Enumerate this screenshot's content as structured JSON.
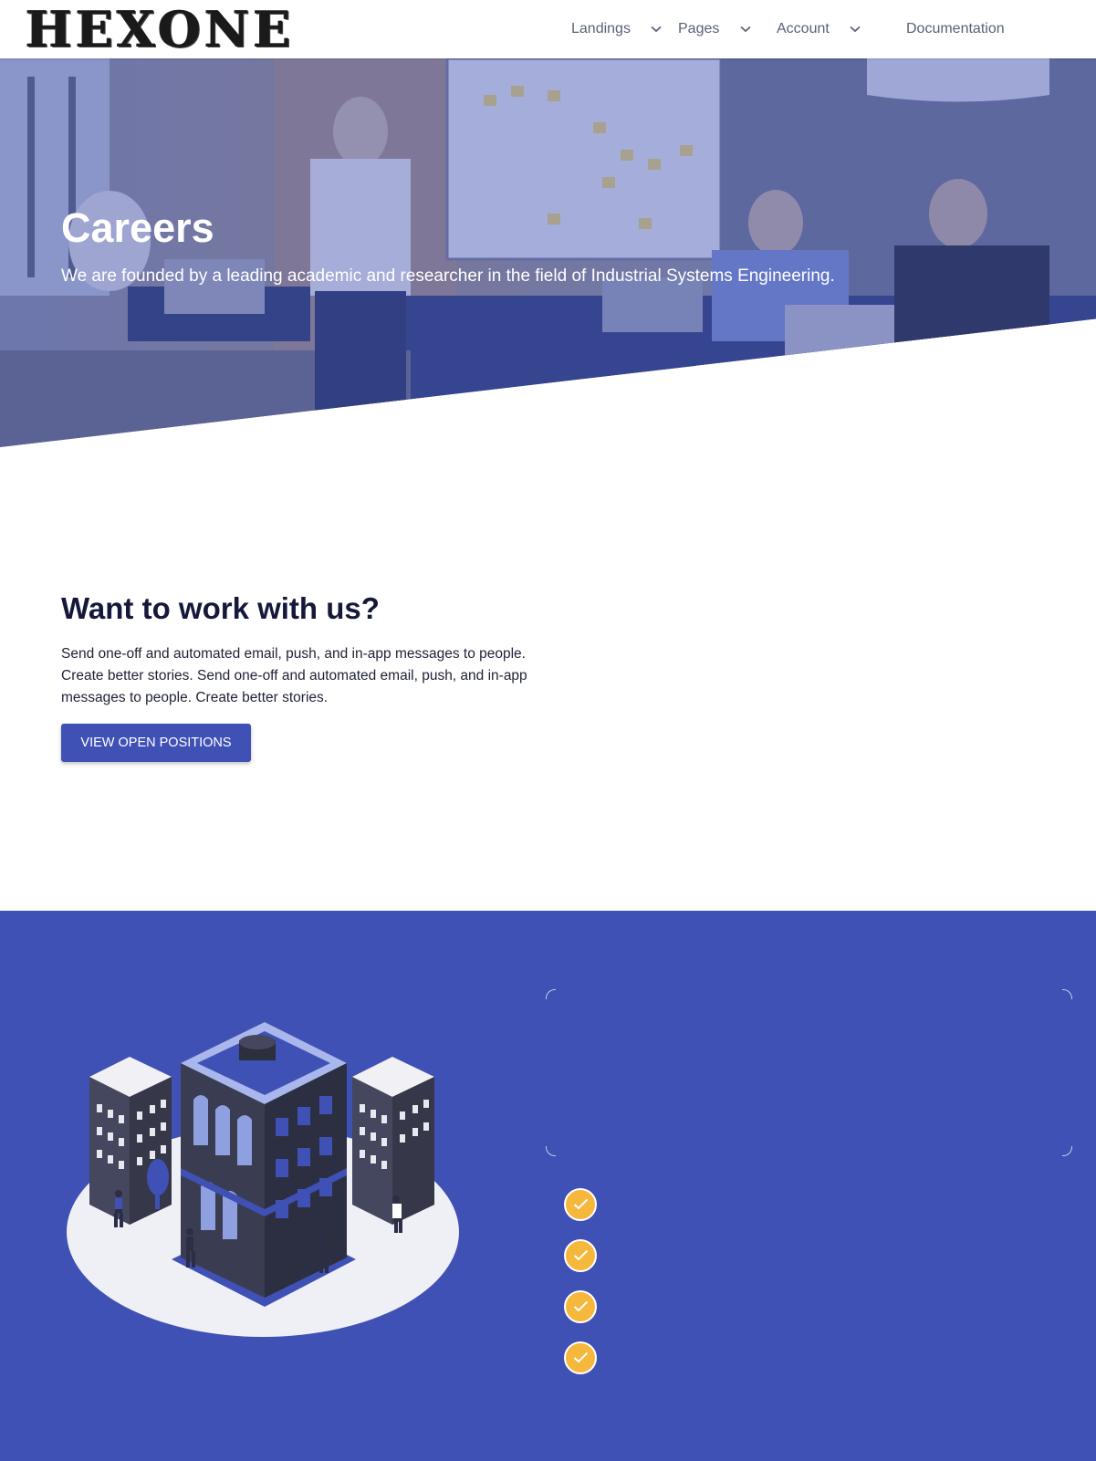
{
  "header": {
    "logo": "HEXONE",
    "nav": [
      {
        "label": "Landings",
        "has_dropdown": true
      },
      {
        "label": "Pages",
        "has_dropdown": true
      },
      {
        "label": "Account",
        "has_dropdown": true
      },
      {
        "label": "Documentation",
        "has_dropdown": false
      }
    ]
  },
  "hero": {
    "title": "Careers",
    "subtitle": "We are founded by a leading academic and researcher in the field of Industrial Systems Engineering."
  },
  "work": {
    "title": "Want to work with us?",
    "text": "Send one-off and automated email, push, and in-app messages to people. Create better stories. Send one-off and automated email, push, and in-app messages to people. Create better stories.",
    "button": "VIEW OPEN POSITIONS"
  },
  "features": {
    "check_count": 4,
    "icon": "check-icon"
  },
  "colors": {
    "primary": "#3f51b5",
    "check": "#f5b83d",
    "title": "#15183a",
    "nav_text": "#5a6278"
  }
}
